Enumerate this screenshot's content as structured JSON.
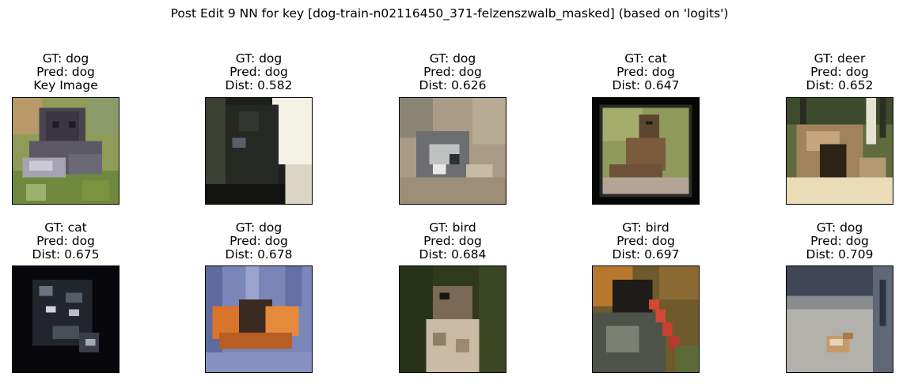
{
  "title": "Post Edit 9 NN for key [dog-train-n02116450_371-felzenszwalb_masked] (based on 'logits')",
  "panels": [
    {
      "gt": "GT: dog",
      "pred": "Pred: dog",
      "extra": "Key Image",
      "thumbnail_subject": "dark dog lying on grass"
    },
    {
      "gt": "GT: dog",
      "pred": "Pred: dog",
      "extra": "Dist: 0.582",
      "thumbnail_subject": "black dog close-up"
    },
    {
      "gt": "GT: dog",
      "pred": "Pred: dog",
      "extra": "Dist: 0.626",
      "thumbnail_subject": "grey dog on sand"
    },
    {
      "gt": "GT: cat",
      "pred": "Pred: dog",
      "extra": "Dist: 0.647",
      "thumbnail_subject": "framed cat on grass"
    },
    {
      "gt": "GT: deer",
      "pred": "Pred: dog",
      "extra": "Dist: 0.652",
      "thumbnail_subject": "brown animal in forest"
    },
    {
      "gt": "GT: cat",
      "pred": "Pred: dog",
      "extra": "Dist: 0.675",
      "thumbnail_subject": "dark cat face"
    },
    {
      "gt": "GT: dog",
      "pred": "Pred: dog",
      "extra": "Dist: 0.678",
      "thumbnail_subject": "orange dogs on blue"
    },
    {
      "gt": "GT: bird",
      "pred": "Pred: dog",
      "extra": "Dist: 0.684",
      "thumbnail_subject": "hawk on green"
    },
    {
      "gt": "GT: bird",
      "pred": "Pred: dog",
      "extra": "Dist: 0.697",
      "thumbnail_subject": "bird with red beak"
    },
    {
      "gt": "GT: dog",
      "pred": "Pred: dog",
      "extra": "Dist: 0.709",
      "thumbnail_subject": "small dog on grey floor"
    }
  ]
}
